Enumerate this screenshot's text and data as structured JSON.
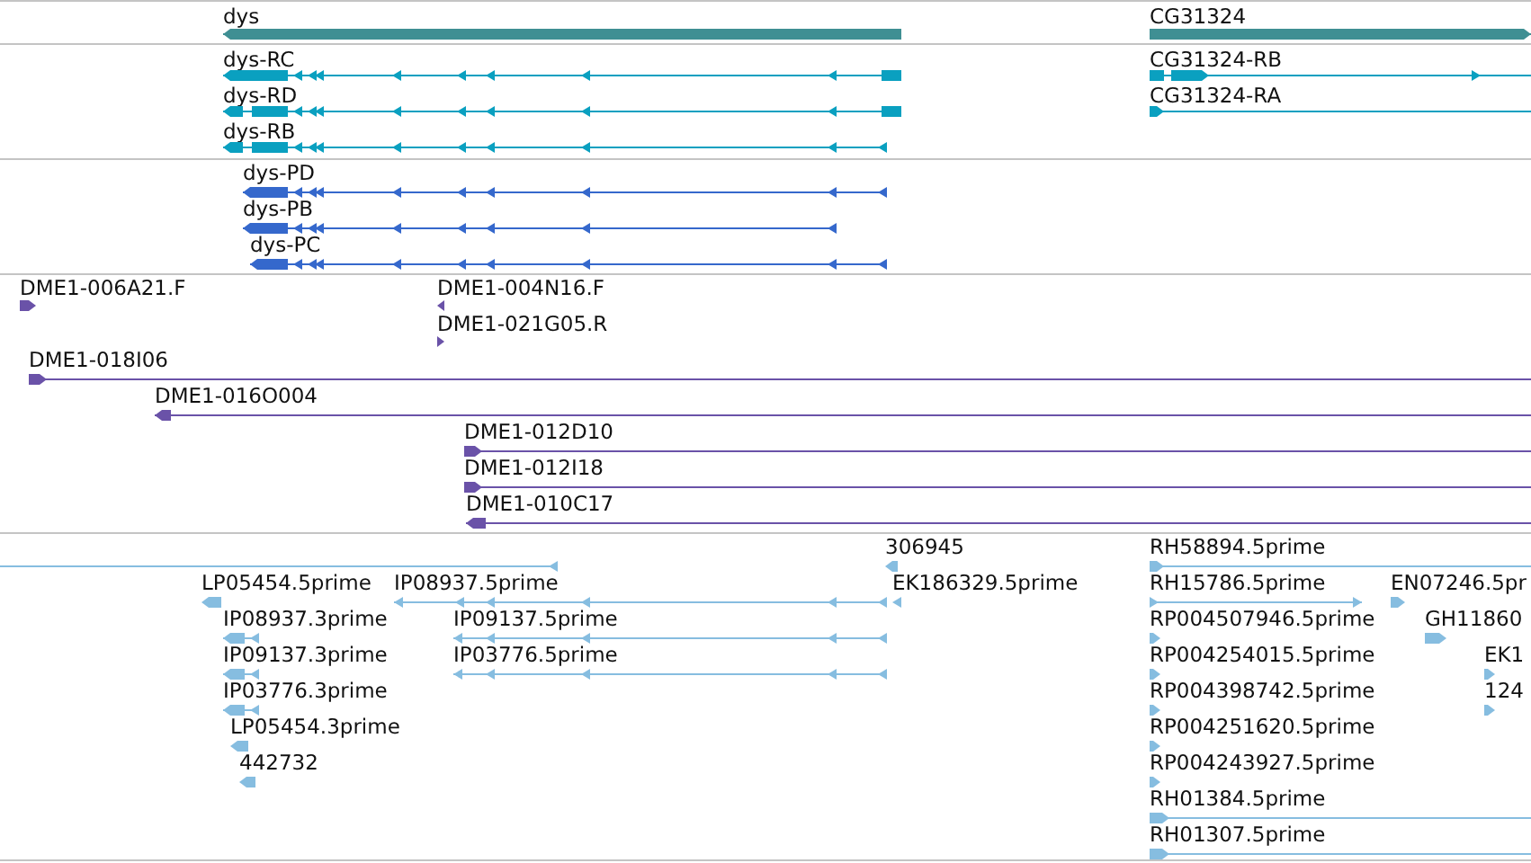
{
  "tracks": [
    {
      "features": [
        {
          "label": "dys",
          "reverse": true
        },
        {
          "label": "CG31324",
          "reverse": false
        }
      ]
    },
    {
      "features": [
        {
          "label": "dys-RC",
          "reverse": true
        },
        {
          "label": "dys-RD",
          "reverse": true
        },
        {
          "label": "dys-RB",
          "reverse": true
        },
        {
          "label": "CG31324-RB",
          "reverse": false
        },
        {
          "label": "CG31324-RA",
          "reverse": false
        }
      ]
    },
    {
      "features": [
        {
          "label": "dys-PD",
          "reverse": true
        },
        {
          "label": "dys-PB",
          "reverse": true
        },
        {
          "label": "dys-PC",
          "reverse": true
        }
      ]
    },
    {
      "features": [
        {
          "label": "DME1-006A21.F",
          "reverse": false
        },
        {
          "label": "DME1-004N16.F",
          "reverse": true
        },
        {
          "label": "DME1-021G05.R",
          "reverse": false
        },
        {
          "label": "DME1-018I06",
          "reverse": false
        },
        {
          "label": "DME1-016O004",
          "reverse": true
        },
        {
          "label": "DME1-012D10",
          "reverse": false
        },
        {
          "label": "DME1-012I18",
          "reverse": false
        },
        {
          "label": "DME1-010C17",
          "reverse": true
        }
      ]
    },
    {
      "features": [
        {
          "reverse": true
        },
        {
          "label": "306945",
          "reverse": true
        },
        {
          "label": "LP05454.5prime",
          "reverse": true
        },
        {
          "label": "IP08937.5prime",
          "reverse": true
        },
        {
          "label": "EK186329.5prime",
          "reverse": true
        },
        {
          "label": "IP08937.3prime",
          "reverse": true
        },
        {
          "label": "IP09137.5prime",
          "reverse": true
        },
        {
          "label": "IP09137.3prime",
          "reverse": true
        },
        {
          "label": "IP03776.5prime",
          "reverse": true
        },
        {
          "label": "IP03776.3prime",
          "reverse": true
        },
        {
          "label": "LP05454.3prime",
          "reverse": true
        },
        {
          "label": "442732",
          "reverse": true
        },
        {
          "label": "RH58894.5prime",
          "reverse": false
        },
        {
          "label": "RH15786.5prime",
          "reverse": false
        },
        {
          "label": "EN07246.5pr",
          "reverse": false
        },
        {
          "label": "RP004507946.5prime",
          "reverse": false
        },
        {
          "label": "GH11860",
          "reverse": false
        },
        {
          "label": "RP004254015.5prime",
          "reverse": false
        },
        {
          "label": "EK1",
          "reverse": false
        },
        {
          "label": "RP004398742.5prime",
          "reverse": false
        },
        {
          "label": "124",
          "reverse": false
        },
        {
          "label": "RP004251620.5prime",
          "reverse": false
        },
        {
          "label": "RP004243927.5prime",
          "reverse": false
        },
        {
          "label": "RH01384.5prime",
          "reverse": false
        },
        {
          "label": "RH01307.5prime",
          "reverse": false
        }
      ]
    }
  ]
}
